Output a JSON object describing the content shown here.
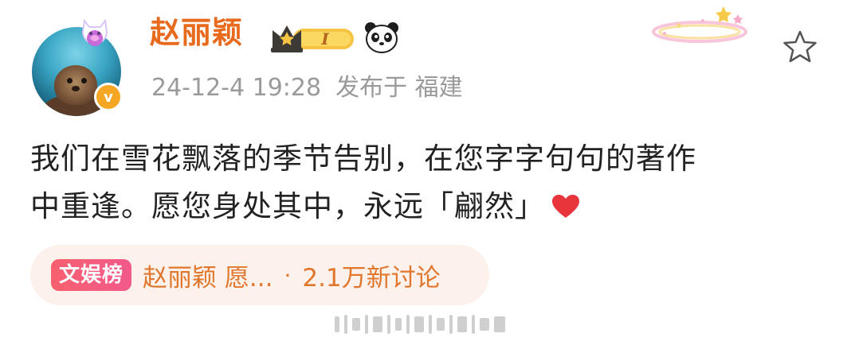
{
  "post": {
    "username": "赵丽颖",
    "vip_level": "I",
    "timestamp": "24-12-4 19:28",
    "location": "发布于 福建",
    "content_line1": "我们在雪花飘落的季节告别，在您字字句句的著作",
    "content_line2": "中重逢。愿您身处其中，永远「翩然」",
    "verified_mark": "v"
  },
  "topic": {
    "tag": "文娱榜",
    "title": "赵丽颖 愿...",
    "separator": "·",
    "discussions": "2.1万新讨论"
  },
  "colors": {
    "username": "#e86b1d",
    "meta": "#9a9a9a",
    "text": "#222222",
    "pill_bg": "#fdf1ec",
    "pill_text": "#e0772d",
    "tag_bg": "#f7606f"
  },
  "icons": [
    "avatar-frame-icon",
    "verified-icon",
    "vip-crown-icon",
    "panda-icon",
    "sparkle-decoration-icon",
    "star-icon",
    "heart-icon"
  ]
}
